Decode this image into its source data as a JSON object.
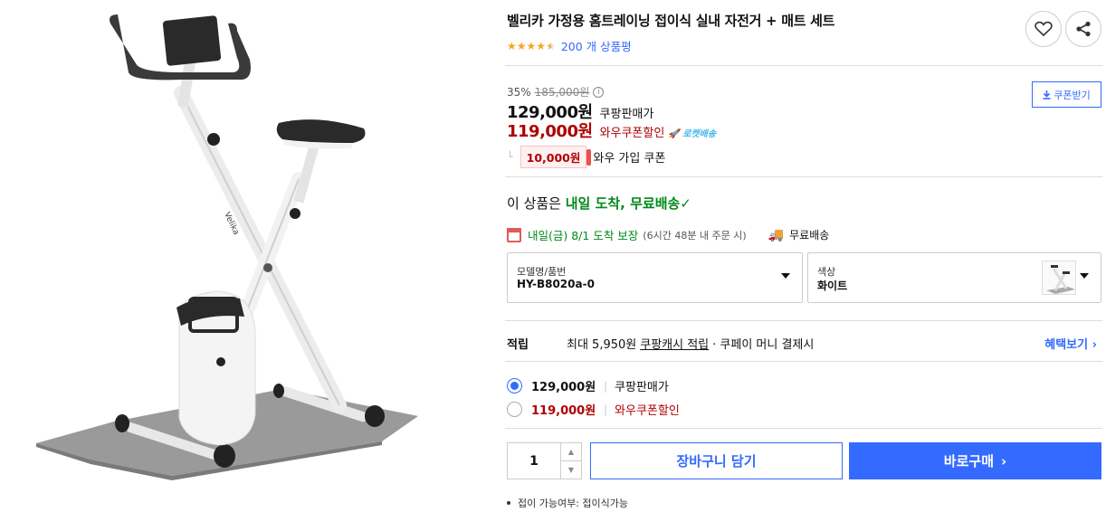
{
  "product": {
    "title": "벨리카 가정용 홈트레이닝 접이식 실내 자전거 + 매트 세트",
    "rating_value": 4.5,
    "review_count": "200 개 상품평",
    "image_icon": "exercise-bike-image",
    "brand_on_frame": "Velika"
  },
  "actions": {
    "wishlist_icon": "heart-icon",
    "share_icon": "share-icon",
    "coupon_button": "쿠폰받기"
  },
  "pricing": {
    "discount_rate": "35%",
    "original_price": "185,000원",
    "sale_price": "129,000원",
    "sale_label": "쿠팡판매가",
    "wow_price": "119,000원",
    "wow_label": "와우쿠폰할인",
    "rocket_badge": "로켓배송",
    "coupon_amount": "10,000원",
    "coupon_label": "와우 가입 쿠폰"
  },
  "delivery": {
    "headline_prefix": "이 상품은 ",
    "headline_highlight": "내일 도착, 무료배송",
    "date_text": "내일(금) 8/1 도착 보장",
    "condition_text": "(6시간 48분 내 주문 시)",
    "free_shipping": "무료배송"
  },
  "options": {
    "model_label": "모델명/품번",
    "model_value": "HY-B8020a-0",
    "color_label": "색상",
    "color_value": "화이트"
  },
  "rewards": {
    "title": "적립",
    "max_text": "최대 5,950원",
    "cash_link": "쿠팡캐시 적립",
    "pay_text": "· 쿠페이 머니 결제시",
    "more": "혜택보기"
  },
  "price_options": [
    {
      "price": "129,000원",
      "label": "쿠팡판매가",
      "checked": true
    },
    {
      "price": "119,000원",
      "label": "와우쿠폰할인",
      "checked": false
    }
  ],
  "purchase": {
    "quantity": "1",
    "cart_button": "장바구니 담기",
    "buy_button": "바로구매"
  },
  "spec": {
    "text": "접이 가능여부: 접이식가능"
  },
  "colors": {
    "brand_blue": "#346aff",
    "price_red": "#ae0000",
    "delivery_green": "#00891a",
    "star": "#f5a623"
  }
}
